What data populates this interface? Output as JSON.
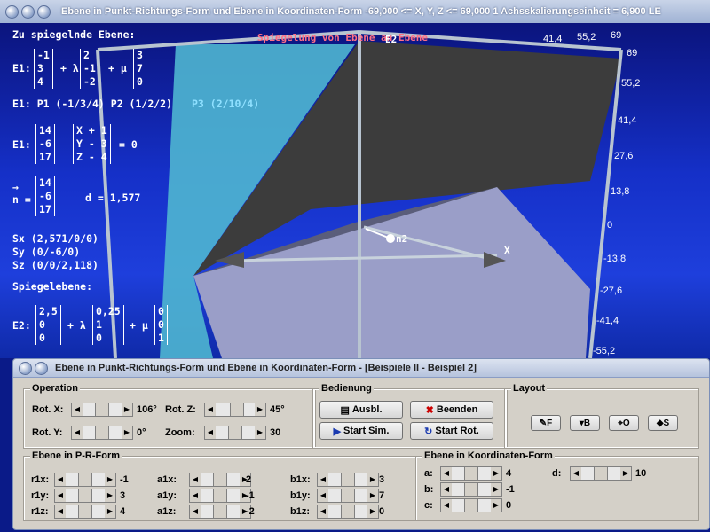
{
  "window": {
    "title": "Ebene in Punkt-Richtungs-Form und Ebene in Koordinaten-Form    -69,000 <= X, Y, Z <= 69,000    1 Achsskalierungseinheit = 6,900 LE"
  },
  "scene": {
    "heading": "Zu spiegelnde Ebene:",
    "overlay_title": "Spiegelung von Ebene an Ebene",
    "e1_param": {
      "label": "E1:",
      "v0": [
        "-1",
        "3",
        "4"
      ],
      "lambda": "+ λ",
      "v1": [
        "2",
        "-1",
        "-2"
      ],
      "mu": "+ μ",
      "v2": [
        "3",
        "7",
        "0"
      ]
    },
    "e1_points": "E1:  P1 (-1/3/4)   P2 (1/2/2)",
    "e1_p3": "P3 (2/10/4)",
    "e1_coord": {
      "label": "E1:",
      "n": [
        "14",
        "-6",
        "17"
      ],
      "xyz": [
        "X + 1",
        "Y - 3",
        "Z - 4"
      ],
      "eq": "= 0"
    },
    "normal": {
      "arrow": "→",
      "label": "n =",
      "n": [
        "14",
        "-6",
        "17"
      ],
      "d_text": "d = 1,577"
    },
    "intercepts": [
      "Sx (2,571/0/0)",
      "Sy (0/-6/0)",
      "Sz (0/0/2,118)"
    ],
    "mirror_heading": "Spiegelebene:",
    "e2": {
      "label": "E2:",
      "v0": [
        "2,5",
        "0",
        "0"
      ],
      "lambda": "+ λ",
      "v1": [
        "0,25",
        "1",
        "0"
      ],
      "mu": "+ μ",
      "v2": [
        "0",
        "0",
        "1"
      ]
    },
    "axis_ticks": [
      "69",
      "55,2",
      "41,4",
      "27,6",
      "13,8",
      "0",
      "-13,8",
      "-27,6",
      "-41,4",
      "-55,2"
    ],
    "top_ticks": [
      "41,4",
      "55,2",
      "69"
    ],
    "n2_label": "n2",
    "x_label": "X",
    "z_label": "E2"
  },
  "panel": {
    "title": "Ebene in Punkt-Richtungs-Form und Ebene in Koordinaten-Form - [Beispiele II - Beispiel 2]",
    "operation": {
      "label": "Operation",
      "rot_x": {
        "label": "Rot. X:",
        "value": "106°"
      },
      "rot_z": {
        "label": "Rot. Z:",
        "value": "45°"
      },
      "rot_y": {
        "label": "Rot. Y:",
        "value": "0°"
      },
      "zoom": {
        "label": "Zoom:",
        "value": "30"
      }
    },
    "bedienung": {
      "label": "Bedienung",
      "ausbl": "Ausbl.",
      "beenden": "Beenden",
      "start_sim": "Start Sim.",
      "start_rot": "Start Rot."
    },
    "layout": {
      "label": "Layout",
      "f": "F",
      "b": "B",
      "o": "O",
      "s": "S"
    },
    "prform": {
      "label": "Ebene in P-R-Form",
      "rows": [
        {
          "r": "r1x:",
          "rv": "-1",
          "a": "a1x:",
          "av": "2",
          "b": "b1x:",
          "bv": "3"
        },
        {
          "r": "r1y:",
          "rv": "3",
          "a": "a1y:",
          "av": "-1",
          "b": "b1y:",
          "bv": "7"
        },
        {
          "r": "r1z:",
          "rv": "4",
          "a": "a1z:",
          "av": "-2",
          "b": "b1z:",
          "bv": "0"
        }
      ]
    },
    "koordform": {
      "label": "Ebene in Koordinaten-Form",
      "a": {
        "label": "a:",
        "value": "4"
      },
      "b": {
        "label": "b:",
        "value": "-1"
      },
      "c": {
        "label": "c:",
        "value": "0"
      },
      "d": {
        "label": "d:",
        "value": "10"
      }
    }
  }
}
